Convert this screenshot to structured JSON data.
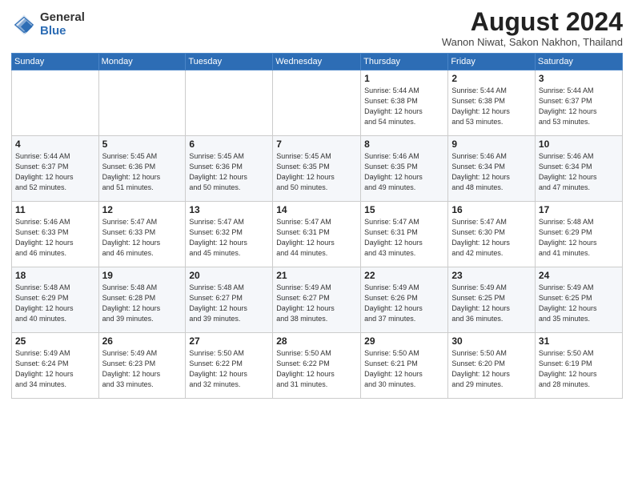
{
  "logo": {
    "general": "General",
    "blue": "Blue"
  },
  "title": "August 2024",
  "subtitle": "Wanon Niwat, Sakon Nakhon, Thailand",
  "headers": [
    "Sunday",
    "Monday",
    "Tuesday",
    "Wednesday",
    "Thursday",
    "Friday",
    "Saturday"
  ],
  "weeks": [
    [
      {
        "day": "",
        "info": ""
      },
      {
        "day": "",
        "info": ""
      },
      {
        "day": "",
        "info": ""
      },
      {
        "day": "",
        "info": ""
      },
      {
        "day": "1",
        "info": "Sunrise: 5:44 AM\nSunset: 6:38 PM\nDaylight: 12 hours\nand 54 minutes."
      },
      {
        "day": "2",
        "info": "Sunrise: 5:44 AM\nSunset: 6:38 PM\nDaylight: 12 hours\nand 53 minutes."
      },
      {
        "day": "3",
        "info": "Sunrise: 5:44 AM\nSunset: 6:37 PM\nDaylight: 12 hours\nand 53 minutes."
      }
    ],
    [
      {
        "day": "4",
        "info": "Sunrise: 5:44 AM\nSunset: 6:37 PM\nDaylight: 12 hours\nand 52 minutes."
      },
      {
        "day": "5",
        "info": "Sunrise: 5:45 AM\nSunset: 6:36 PM\nDaylight: 12 hours\nand 51 minutes."
      },
      {
        "day": "6",
        "info": "Sunrise: 5:45 AM\nSunset: 6:36 PM\nDaylight: 12 hours\nand 50 minutes."
      },
      {
        "day": "7",
        "info": "Sunrise: 5:45 AM\nSunset: 6:35 PM\nDaylight: 12 hours\nand 50 minutes."
      },
      {
        "day": "8",
        "info": "Sunrise: 5:46 AM\nSunset: 6:35 PM\nDaylight: 12 hours\nand 49 minutes."
      },
      {
        "day": "9",
        "info": "Sunrise: 5:46 AM\nSunset: 6:34 PM\nDaylight: 12 hours\nand 48 minutes."
      },
      {
        "day": "10",
        "info": "Sunrise: 5:46 AM\nSunset: 6:34 PM\nDaylight: 12 hours\nand 47 minutes."
      }
    ],
    [
      {
        "day": "11",
        "info": "Sunrise: 5:46 AM\nSunset: 6:33 PM\nDaylight: 12 hours\nand 46 minutes."
      },
      {
        "day": "12",
        "info": "Sunrise: 5:47 AM\nSunset: 6:33 PM\nDaylight: 12 hours\nand 46 minutes."
      },
      {
        "day": "13",
        "info": "Sunrise: 5:47 AM\nSunset: 6:32 PM\nDaylight: 12 hours\nand 45 minutes."
      },
      {
        "day": "14",
        "info": "Sunrise: 5:47 AM\nSunset: 6:31 PM\nDaylight: 12 hours\nand 44 minutes."
      },
      {
        "day": "15",
        "info": "Sunrise: 5:47 AM\nSunset: 6:31 PM\nDaylight: 12 hours\nand 43 minutes."
      },
      {
        "day": "16",
        "info": "Sunrise: 5:47 AM\nSunset: 6:30 PM\nDaylight: 12 hours\nand 42 minutes."
      },
      {
        "day": "17",
        "info": "Sunrise: 5:48 AM\nSunset: 6:29 PM\nDaylight: 12 hours\nand 41 minutes."
      }
    ],
    [
      {
        "day": "18",
        "info": "Sunrise: 5:48 AM\nSunset: 6:29 PM\nDaylight: 12 hours\nand 40 minutes."
      },
      {
        "day": "19",
        "info": "Sunrise: 5:48 AM\nSunset: 6:28 PM\nDaylight: 12 hours\nand 39 minutes."
      },
      {
        "day": "20",
        "info": "Sunrise: 5:48 AM\nSunset: 6:27 PM\nDaylight: 12 hours\nand 39 minutes."
      },
      {
        "day": "21",
        "info": "Sunrise: 5:49 AM\nSunset: 6:27 PM\nDaylight: 12 hours\nand 38 minutes."
      },
      {
        "day": "22",
        "info": "Sunrise: 5:49 AM\nSunset: 6:26 PM\nDaylight: 12 hours\nand 37 minutes."
      },
      {
        "day": "23",
        "info": "Sunrise: 5:49 AM\nSunset: 6:25 PM\nDaylight: 12 hours\nand 36 minutes."
      },
      {
        "day": "24",
        "info": "Sunrise: 5:49 AM\nSunset: 6:25 PM\nDaylight: 12 hours\nand 35 minutes."
      }
    ],
    [
      {
        "day": "25",
        "info": "Sunrise: 5:49 AM\nSunset: 6:24 PM\nDaylight: 12 hours\nand 34 minutes."
      },
      {
        "day": "26",
        "info": "Sunrise: 5:49 AM\nSunset: 6:23 PM\nDaylight: 12 hours\nand 33 minutes."
      },
      {
        "day": "27",
        "info": "Sunrise: 5:50 AM\nSunset: 6:22 PM\nDaylight: 12 hours\nand 32 minutes."
      },
      {
        "day": "28",
        "info": "Sunrise: 5:50 AM\nSunset: 6:22 PM\nDaylight: 12 hours\nand 31 minutes."
      },
      {
        "day": "29",
        "info": "Sunrise: 5:50 AM\nSunset: 6:21 PM\nDaylight: 12 hours\nand 30 minutes."
      },
      {
        "day": "30",
        "info": "Sunrise: 5:50 AM\nSunset: 6:20 PM\nDaylight: 12 hours\nand 29 minutes."
      },
      {
        "day": "31",
        "info": "Sunrise: 5:50 AM\nSunset: 6:19 PM\nDaylight: 12 hours\nand 28 minutes."
      }
    ]
  ]
}
